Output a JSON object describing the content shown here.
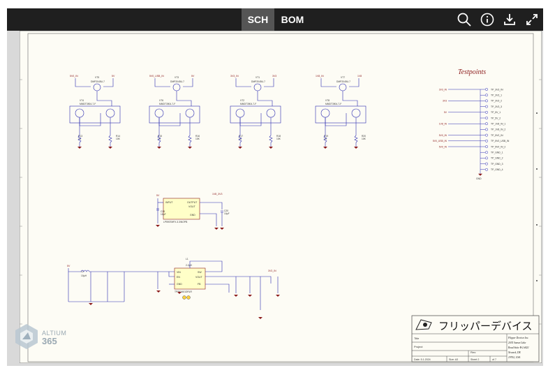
{
  "toolbar": {
    "tabs": [
      {
        "label": "SCH",
        "active": true
      },
      {
        "label": "BOM",
        "active": false
      }
    ],
    "icons": [
      "search-icon",
      "info-icon",
      "download-icon",
      "fullscreen-icon"
    ]
  },
  "schematic": {
    "title": "Testpoints",
    "fet_blocks": [
      {
        "rail": "5V0_IN",
        "rail_right": "5V",
        "q_top": "VT5",
        "q_top_part": "DMP2045U-7",
        "q_bottom": "VT4",
        "q_bottom_part": "MMDT3904-7-F",
        "r_left": "R13",
        "r_left_val": "1K",
        "r_right": "R14",
        "r_right_val": "10K"
      },
      {
        "rail": "5V0_USB_IN",
        "rail_right": "5V",
        "q_top": "VT3",
        "q_top_part": "DMP2045U-7",
        "q_bottom": "VT6",
        "q_bottom_part": "MMDT3904-7-F",
        "r_left": "R15",
        "r_left_val": "1K",
        "r_right": "R16",
        "r_right_val": "10K"
      },
      {
        "rail": "3V3_IN",
        "rail_right": "3V3",
        "q_top": "VT1",
        "q_top_part": "DMP2045U-7",
        "q_bottom": "VT2",
        "q_bottom_part": "MMDT3904-7-F",
        "r_left": "R17",
        "r_left_val": "1K",
        "r_right": "R18",
        "r_right_val": "10K"
      },
      {
        "rail": "1V8_IN",
        "rail_right": "1V8",
        "q_top": "VT7",
        "q_top_part": "DMP2045U-7",
        "q_bottom": "VT8",
        "q_bottom_part": "MMDT3904-7-F",
        "r_left": "R19",
        "r_left_val": "1K",
        "r_right": "R20",
        "r_right_val": "10K"
      }
    ],
    "testpoints": [
      {
        "net": "3V3_IN",
        "label": "TP_3V3_IN"
      },
      {
        "net": "",
        "label": "TP_3V3_1"
      },
      {
        "net": "3V3",
        "label": "TP_3V3_2"
      },
      {
        "net": "",
        "label": "TP_3V3_3"
      },
      {
        "net": "5V",
        "label": "TP_5V_1"
      },
      {
        "net": "",
        "label": "TP_5V_2"
      },
      {
        "net": "1V8_IN",
        "label": "TP_1V8_IN_1"
      },
      {
        "net": "",
        "label": "TP_1V8_IN_2"
      },
      {
        "net": "5V0_IN",
        "label": "TP_5V0_IN"
      },
      {
        "net": "5V0_USB_IN",
        "label": "TP_5V0_USB_IN"
      },
      {
        "net": "5V0_IN",
        "label": "TP_5V0_IN_2"
      },
      {
        "net": "",
        "label": "TP_GND_1"
      },
      {
        "net": "",
        "label": "TP_GND_2"
      },
      {
        "net": "",
        "label": "TP_GND_3"
      },
      {
        "net": "",
        "label": "TP_GND_4"
      }
    ],
    "gnd_label": "GND",
    "ldo": {
      "input": "INPUT",
      "output": "OUTPUT",
      "vout": "VOUT",
      "gnd": "GND",
      "part": "LP5907MFX-3.3/NOPB",
      "in_net": "5V",
      "out_net": "1V8_3V3",
      "cin": "C19",
      "cin_val": "10µF",
      "cout": "C20",
      "cout_val": "10µF"
    },
    "buck": {
      "vin": "VIN",
      "en": "EN",
      "gnd": "GND",
      "sw": "SW",
      "vout": "VOUT",
      "fb": "FB",
      "part": "TPS62A01DRLR",
      "inductor": "L1",
      "inductor_val": "2.2µH",
      "in_net": "5V",
      "out_net": "3V3_IN",
      "in_inductor": "L2",
      "in_inductor_val": "10µH"
    },
    "logo_text": "フリッパーデバイス",
    "company": [
      "Flipper Devices Inc.",
      "2035 Sunset Lake",
      "Road Suite B-2 #421",
      "Newark, DE",
      "19702, USA"
    ],
    "title_block": {
      "title": "Title",
      "project": "Project",
      "rev": "Rev:",
      "date": "Date: 5.1.2024",
      "size": "Size: A3",
      "sheet": "Sheet 2",
      "of": "of 7"
    }
  },
  "watermark": {
    "brand": "ALTIUM",
    "version": "365"
  }
}
